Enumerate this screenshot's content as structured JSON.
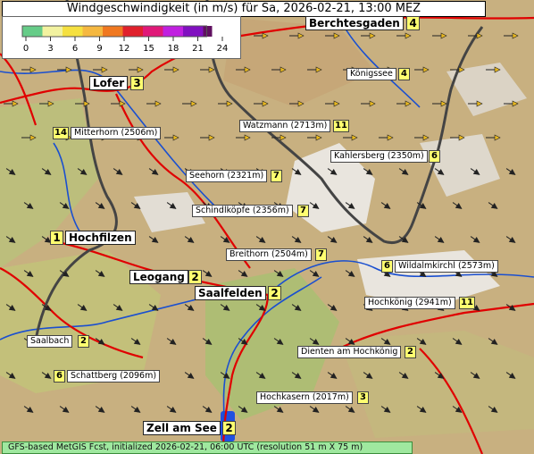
{
  "title": "Windgeschwindigkeit (in m/s) für Sa, 2026-02-21, 13:00 MEZ",
  "legend": {
    "ticks": [
      "0",
      "3",
      "6",
      "9",
      "12",
      "15",
      "18",
      "21",
      "24"
    ],
    "colors": [
      "#66cc88",
      "#f2f2a0",
      "#f5e040",
      "#f5b840",
      "#f07820",
      "#e0202c",
      "#e01878",
      "#c020e0",
      "#8010c0",
      "#601060"
    ]
  },
  "places": [
    {
      "name": "Berchtesgaden",
      "value": "4"
    },
    {
      "name": "Königssee",
      "value": "4"
    },
    {
      "name": "Lofer",
      "value": "3"
    },
    {
      "name": "Watzmann (2713m)",
      "value": "11"
    },
    {
      "name": "Mitterhorn (2506m)",
      "value": "14"
    },
    {
      "name": "Kahlersberg (2350m)",
      "value": "6"
    },
    {
      "name": "Seehorn (2321m)",
      "value": "7"
    },
    {
      "name": "Schindlköpfe (2356m)",
      "value": "7"
    },
    {
      "name": "Hochfilzen",
      "value": "1"
    },
    {
      "name": "Breithorn (2504m)",
      "value": "7"
    },
    {
      "name": "Wildalmkirchl (2573m)",
      "value": "6"
    },
    {
      "name": "Leogang",
      "value": "2"
    },
    {
      "name": "Saalfelden",
      "value": "2"
    },
    {
      "name": "Hochkönig (2941m)",
      "value": "11"
    },
    {
      "name": "Saalbach",
      "value": "2"
    },
    {
      "name": "Dienten am Hochkönig",
      "value": "2"
    },
    {
      "name": "Schattberg (2096m)",
      "value": "6"
    },
    {
      "name": "Hochkasern (2017m)",
      "value": "3"
    },
    {
      "name": "Zell am See",
      "value": "2"
    }
  ],
  "footer": "GFS-based MetGIS Fcst, initialized 2026-02-21, 06:00 UTC  (resolution 51 m X 75 m)",
  "colors": {
    "terrain": "#c9b38a",
    "snow": "#eeeeee",
    "river": "#1a4fd0",
    "road": "#e00000",
    "border": "#444444",
    "arrow_strong": "#e8b820",
    "arrow_calm": "#222222"
  }
}
